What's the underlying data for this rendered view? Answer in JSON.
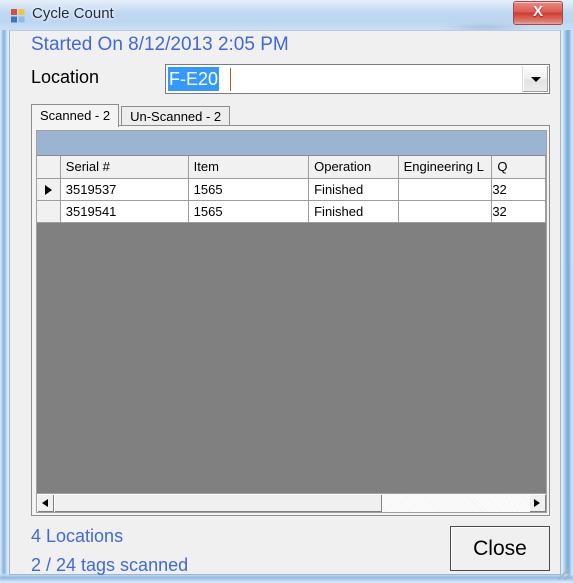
{
  "window": {
    "title": "Cycle Count",
    "icon": "windows-form-icon",
    "close_label": "X"
  },
  "header": {
    "started_on": "Started On 8/12/2013 2:05 PM",
    "started_on_color": "#4169d8"
  },
  "location": {
    "label": "Location",
    "value": "F-E20",
    "dropdown_icon": "chevron-down-icon"
  },
  "tabs": [
    {
      "label": "Scanned - 2",
      "active": true
    },
    {
      "label": "Un-Scanned - 2",
      "active": false
    }
  ],
  "grid": {
    "columns": [
      "Serial #",
      "Item",
      "Operation",
      "Engineering L",
      "Q"
    ],
    "rows": [
      {
        "selected": true,
        "serial": "3519537",
        "item": "1565",
        "operation": "Finished",
        "engineering_l": "",
        "q": "32"
      },
      {
        "selected": false,
        "serial": "3519541",
        "item": "1565",
        "operation": "Finished",
        "engineering_l": "",
        "q": "32"
      }
    ],
    "empty_background_color": "#808080",
    "caption_band_color": "#9bb4d2",
    "hscroll": {
      "left_arrow_icon": "arrow-left-icon",
      "right_arrow_icon": "arrow-right-icon"
    }
  },
  "status": {
    "locations": "4 Locations",
    "tags": "2 / 24 tags scanned",
    "color": "#4169d8"
  },
  "footer": {
    "close_label": "Close"
  }
}
